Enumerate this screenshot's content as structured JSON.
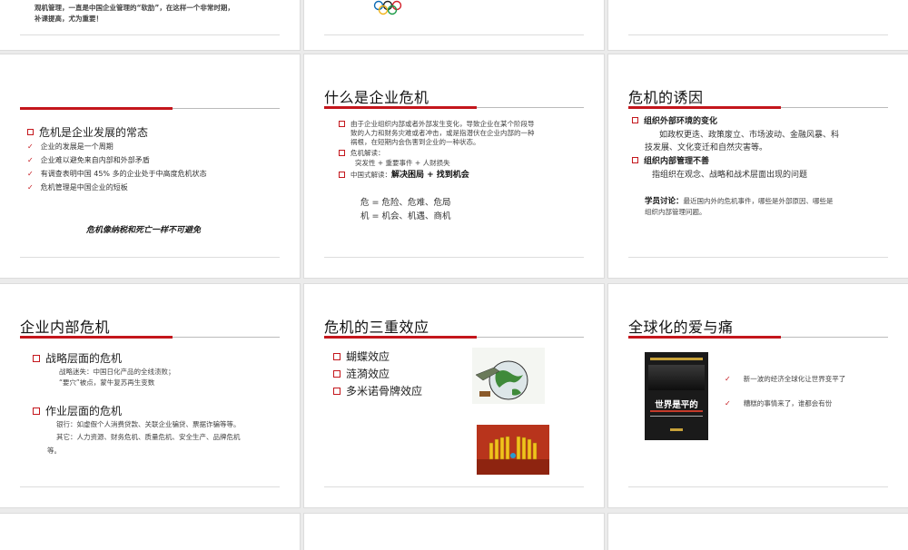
{
  "s0": {
    "line1": "观机管理，一直是中国企业管理的“软肋”，在这样一个非常时期，",
    "line2": "补课提高，尤为重要！"
  },
  "s3": {
    "head": "危机是企业发展的常态",
    "items": [
      "企业的发展是一个周期",
      "企业难以避免来自内部和外部矛盾",
      "有调查表明中国 45% 多的企业处于中高度危机状态",
      "危机管理是中国企业的短板"
    ],
    "quote": "危机像纳税和死亡一样不可避免"
  },
  "s4": {
    "title": "什么是企业危机",
    "p1a": "由于企业组织内部或者外部发生变化，导致企业在某个阶段导",
    "p1b": "致的人力和财务灾难或者冲击，或是指潜伏在企业内部的一种",
    "p1c": "祸根，在短期内会伤害到企业的一种状态。",
    "p2": "危机解读：",
    "p2b": "突发性 + 重要事件 + 人财损失",
    "p3": "中国式解读：",
    "p3b": "解决困局 + 找到机会",
    "w1": "危 = 危险、危难、危局",
    "w2": "机 = 机会、机遇、商机"
  },
  "s5": {
    "title": "危机的诱因",
    "h1": "组织外部环境的变化",
    "t1a": "如政权更迭、政策废立、市场波动、金融风暴、科",
    "t1b": "技发展、文化变迁和自然灾害等。",
    "h2": "组织内部管理不善",
    "t2": "指组织在观念、战略和战术层面出现的问题",
    "d_label": "学员讨论：",
    "d_a": "最近国内外的危机事件，哪些是外部原因、哪些是",
    "d_b": "组织内部管理问题。"
  },
  "s6": {
    "title": "企业内部危机",
    "h1": "战略层面的危机",
    "t1a": "战略迷失：中国日化产品的全线溃败；",
    "t1b": "“要穴”被点，蒙牛复苏再生变数",
    "h2": "作业层面的危机",
    "t2a": "银行：如虚假个人消费贷款、关联企业骗贷、票据诈骗等等。",
    "t2b": "其它：人力资源、财务危机、质量危机、安全生产、品牌危机",
    "t2c": "等。"
  },
  "s7": {
    "title": "危机的三重效应",
    "items": [
      "蝴蝶效应",
      "涟漪效应",
      "多米诺骨牌效应"
    ]
  },
  "s8": {
    "title": "全球化的爱与痛",
    "items": [
      "新一波的经济全球化让世界变平了",
      "糟糕的事情来了，谁都会有份"
    ],
    "book_title": "世界是平的"
  }
}
